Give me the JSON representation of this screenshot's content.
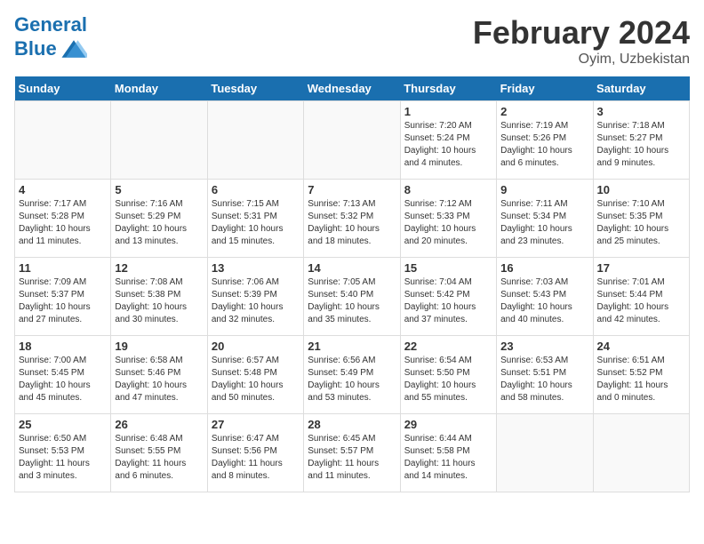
{
  "logo": {
    "line1": "General",
    "line2": "Blue"
  },
  "title": "February 2024",
  "location": "Oyim, Uzbekistan",
  "days_of_week": [
    "Sunday",
    "Monday",
    "Tuesday",
    "Wednesday",
    "Thursday",
    "Friday",
    "Saturday"
  ],
  "weeks": [
    [
      {
        "day": "",
        "info": ""
      },
      {
        "day": "",
        "info": ""
      },
      {
        "day": "",
        "info": ""
      },
      {
        "day": "",
        "info": ""
      },
      {
        "day": "1",
        "info": "Sunrise: 7:20 AM\nSunset: 5:24 PM\nDaylight: 10 hours\nand 4 minutes."
      },
      {
        "day": "2",
        "info": "Sunrise: 7:19 AM\nSunset: 5:26 PM\nDaylight: 10 hours\nand 6 minutes."
      },
      {
        "day": "3",
        "info": "Sunrise: 7:18 AM\nSunset: 5:27 PM\nDaylight: 10 hours\nand 9 minutes."
      }
    ],
    [
      {
        "day": "4",
        "info": "Sunrise: 7:17 AM\nSunset: 5:28 PM\nDaylight: 10 hours\nand 11 minutes."
      },
      {
        "day": "5",
        "info": "Sunrise: 7:16 AM\nSunset: 5:29 PM\nDaylight: 10 hours\nand 13 minutes."
      },
      {
        "day": "6",
        "info": "Sunrise: 7:15 AM\nSunset: 5:31 PM\nDaylight: 10 hours\nand 15 minutes."
      },
      {
        "day": "7",
        "info": "Sunrise: 7:13 AM\nSunset: 5:32 PM\nDaylight: 10 hours\nand 18 minutes."
      },
      {
        "day": "8",
        "info": "Sunrise: 7:12 AM\nSunset: 5:33 PM\nDaylight: 10 hours\nand 20 minutes."
      },
      {
        "day": "9",
        "info": "Sunrise: 7:11 AM\nSunset: 5:34 PM\nDaylight: 10 hours\nand 23 minutes."
      },
      {
        "day": "10",
        "info": "Sunrise: 7:10 AM\nSunset: 5:35 PM\nDaylight: 10 hours\nand 25 minutes."
      }
    ],
    [
      {
        "day": "11",
        "info": "Sunrise: 7:09 AM\nSunset: 5:37 PM\nDaylight: 10 hours\nand 27 minutes."
      },
      {
        "day": "12",
        "info": "Sunrise: 7:08 AM\nSunset: 5:38 PM\nDaylight: 10 hours\nand 30 minutes."
      },
      {
        "day": "13",
        "info": "Sunrise: 7:06 AM\nSunset: 5:39 PM\nDaylight: 10 hours\nand 32 minutes."
      },
      {
        "day": "14",
        "info": "Sunrise: 7:05 AM\nSunset: 5:40 PM\nDaylight: 10 hours\nand 35 minutes."
      },
      {
        "day": "15",
        "info": "Sunrise: 7:04 AM\nSunset: 5:42 PM\nDaylight: 10 hours\nand 37 minutes."
      },
      {
        "day": "16",
        "info": "Sunrise: 7:03 AM\nSunset: 5:43 PM\nDaylight: 10 hours\nand 40 minutes."
      },
      {
        "day": "17",
        "info": "Sunrise: 7:01 AM\nSunset: 5:44 PM\nDaylight: 10 hours\nand 42 minutes."
      }
    ],
    [
      {
        "day": "18",
        "info": "Sunrise: 7:00 AM\nSunset: 5:45 PM\nDaylight: 10 hours\nand 45 minutes."
      },
      {
        "day": "19",
        "info": "Sunrise: 6:58 AM\nSunset: 5:46 PM\nDaylight: 10 hours\nand 47 minutes."
      },
      {
        "day": "20",
        "info": "Sunrise: 6:57 AM\nSunset: 5:48 PM\nDaylight: 10 hours\nand 50 minutes."
      },
      {
        "day": "21",
        "info": "Sunrise: 6:56 AM\nSunset: 5:49 PM\nDaylight: 10 hours\nand 53 minutes."
      },
      {
        "day": "22",
        "info": "Sunrise: 6:54 AM\nSunset: 5:50 PM\nDaylight: 10 hours\nand 55 minutes."
      },
      {
        "day": "23",
        "info": "Sunrise: 6:53 AM\nSunset: 5:51 PM\nDaylight: 10 hours\nand 58 minutes."
      },
      {
        "day": "24",
        "info": "Sunrise: 6:51 AM\nSunset: 5:52 PM\nDaylight: 11 hours\nand 0 minutes."
      }
    ],
    [
      {
        "day": "25",
        "info": "Sunrise: 6:50 AM\nSunset: 5:53 PM\nDaylight: 11 hours\nand 3 minutes."
      },
      {
        "day": "26",
        "info": "Sunrise: 6:48 AM\nSunset: 5:55 PM\nDaylight: 11 hours\nand 6 minutes."
      },
      {
        "day": "27",
        "info": "Sunrise: 6:47 AM\nSunset: 5:56 PM\nDaylight: 11 hours\nand 8 minutes."
      },
      {
        "day": "28",
        "info": "Sunrise: 6:45 AM\nSunset: 5:57 PM\nDaylight: 11 hours\nand 11 minutes."
      },
      {
        "day": "29",
        "info": "Sunrise: 6:44 AM\nSunset: 5:58 PM\nDaylight: 11 hours\nand 14 minutes."
      },
      {
        "day": "",
        "info": ""
      },
      {
        "day": "",
        "info": ""
      }
    ]
  ]
}
